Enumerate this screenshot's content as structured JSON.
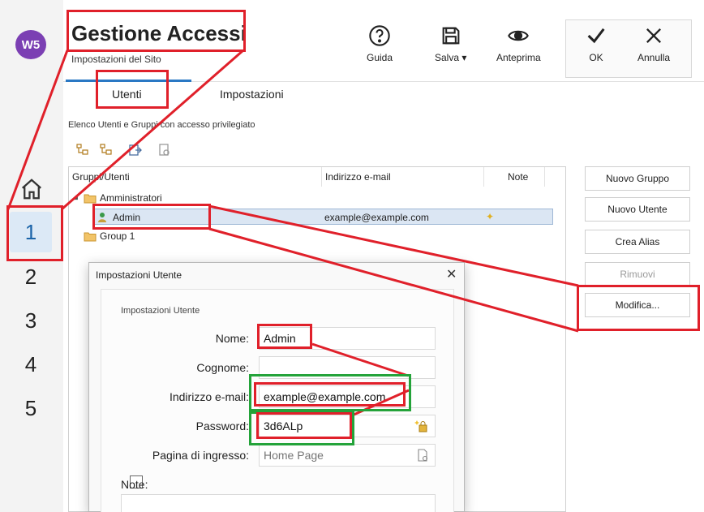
{
  "header": {
    "logo": "W5",
    "title": "Gestione Accessi",
    "subtitle": "Impostazioni del Sito"
  },
  "toolbar": {
    "help_label": "Guida",
    "save_label": "Salva",
    "preview_label": "Anteprima",
    "ok_label": "OK",
    "cancel_label": "Annulla"
  },
  "sidebar": {
    "steps": [
      "1",
      "2",
      "3",
      "4",
      "5"
    ],
    "active_step": "1"
  },
  "tabs": [
    {
      "label": "Utenti",
      "active": true
    },
    {
      "label": "Impostazioni",
      "active": false
    }
  ],
  "main": {
    "section_label": "Elenco Utenti e Gruppi con accesso privilegiato",
    "columns": [
      "Gruppi/Utenti",
      "Indirizzo e-mail",
      "Note"
    ],
    "tree": [
      {
        "label": "Amministratori",
        "type": "group"
      },
      {
        "label": "Admin",
        "type": "user",
        "email": "example@example.com"
      },
      {
        "label": "Group 1",
        "type": "group"
      }
    ]
  },
  "actions": {
    "new_group": "Nuovo Gruppo",
    "new_user": "Nuovo Utente",
    "create_alias": "Crea Alias",
    "remove": "Rimuovi",
    "modify": "Modifica..."
  },
  "dialog": {
    "title": "Impostazioni Utente",
    "group_label": "Impostazioni Utente",
    "name_label": "Nome:",
    "name_value": "Admin",
    "surname_label": "Cognome:",
    "surname_value": "",
    "email_label": "Indirizzo e-mail:",
    "email_value": "example@example.com",
    "password_label": "Password:",
    "password_value": "3d6ALp",
    "entry_page_label": "Pagina di ingresso:",
    "entry_page_placeholder": "Home Page",
    "note_label": "Note:"
  },
  "colors": {
    "accent": "#1b64a8",
    "annotation_red": "#e0202a",
    "annotation_green": "#24a33a"
  }
}
